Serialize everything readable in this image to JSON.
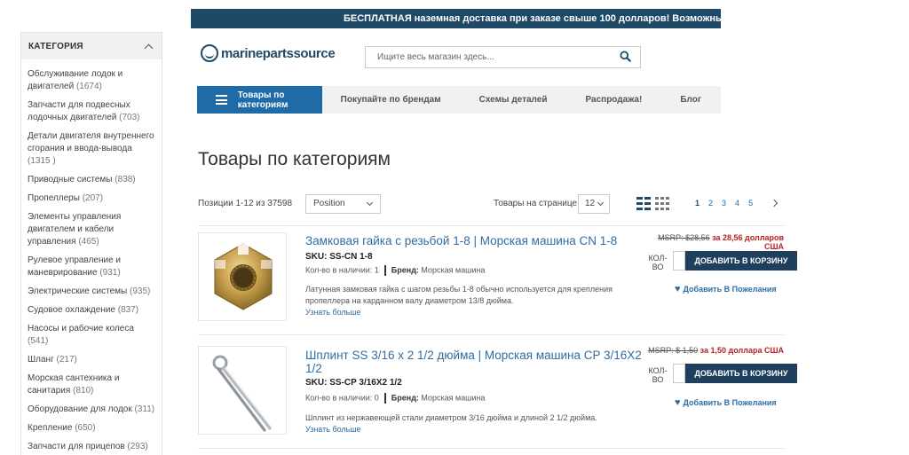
{
  "promo": {
    "text": "БЕСПЛАТНАЯ наземная доставка при заказе свыше 100 долларов! Возможны исключения - под"
  },
  "sidebar": {
    "title": "КАТЕГОРИЯ",
    "items": [
      {
        "label": "Обслуживание лодок и двигателей",
        "count": "(1674)"
      },
      {
        "label": "Запчасти для подвесных лодочных двигателей",
        "count": "(703)"
      },
      {
        "label": "Детали двигателя внутреннего сгорания и ввода-вывода",
        "count": "(1315 )"
      },
      {
        "label": "Приводные системы",
        "count": "(838)"
      },
      {
        "label": "Пропеллеры",
        "count": "(207)"
      },
      {
        "label": "Элементы управления двигателем и кабели управления",
        "count": "(465)"
      },
      {
        "label": "Рулевое управление и маневрирование",
        "count": "(931)"
      },
      {
        "label": "Электрические системы",
        "count": "(935)"
      },
      {
        "label": "Судовое охлаждение",
        "count": "(837)"
      },
      {
        "label": "Насосы и рабочие колеса",
        "count": "(541)"
      },
      {
        "label": "Шланг",
        "count": "(217)"
      },
      {
        "label": "Морская сантехника и санитария",
        "count": "(810)"
      },
      {
        "label": "Оборудование для лодок",
        "count": "(311)"
      },
      {
        "label": "Крепление",
        "count": "(650)"
      },
      {
        "label": "Запчасти для прицепов",
        "count": "(293)"
      }
    ]
  },
  "header": {
    "logo_text": "marinepartssource",
    "search_placeholder": "Ищите весь магазин здесь..."
  },
  "nav": {
    "categories_label": "Товары по категориям",
    "items": [
      "Покупайте по брендам",
      "Схемы деталей",
      "Распродажа!",
      "Блог"
    ]
  },
  "main": {
    "title": "Товары по категориям",
    "toolbar": {
      "positions": "Позиции 1-12 из 37598",
      "sort_value": "Position",
      "per_page_label": "Товары на странице",
      "per_page_value": "12",
      "pages": [
        "1",
        "2",
        "3",
        "4",
        "5"
      ]
    },
    "products": [
      {
        "name": "Замковая гайка с резьбой 1-8 | Морская машина CN 1-8",
        "sku": "SKU: SS-CN 1-8",
        "stock": "Кол-во в наличии: 1",
        "brand_label": "Бренд:",
        "brand": "Морская машина",
        "description": "Латунная замковая гайка с шагом резьбы 1-8 обычно используется для крепления пропеллера на карданном валу диаметром 13/8 дюйма.",
        "more": "Узнать больше",
        "msrp": "MSRP: $28,56",
        "price": "за 28,56 долларов США",
        "qty_label": "КОЛ-ВО",
        "cart": "ДОБАВИТЬ В КОРЗИНУ",
        "wishlist": "Добавить В Пожелания"
      },
      {
        "name": "Шплинт SS 3/16 x 2 1/2 дюйма | Морская машина CP 3/16X2 1/2",
        "sku": "SKU: SS-CP 3/16X2 1/2",
        "stock": "Кол-во в наличии: 0",
        "brand_label": "Бренд:",
        "brand": "Морская машина",
        "description": "Шплинт из нержавеющей стали диаметром 3/16 дюйма и длиной 2 1/2 дюйма.",
        "more": "Узнать больше",
        "msrp": "MSRP: $ 1,50",
        "price": "за 1,50 доллара США",
        "qty_label": "КОЛ-ВО",
        "cart": "ДОБАВИТЬ В КОРЗИНУ",
        "wishlist": "Добавить В Пожелания"
      }
    ]
  },
  "colors": {
    "brand_navy": "#1e4a68",
    "nav_blue": "#1e6ba8",
    "link_blue": "#2e6da4",
    "cart_button": "#1e3f5e",
    "sale_red": "#bb2222"
  }
}
